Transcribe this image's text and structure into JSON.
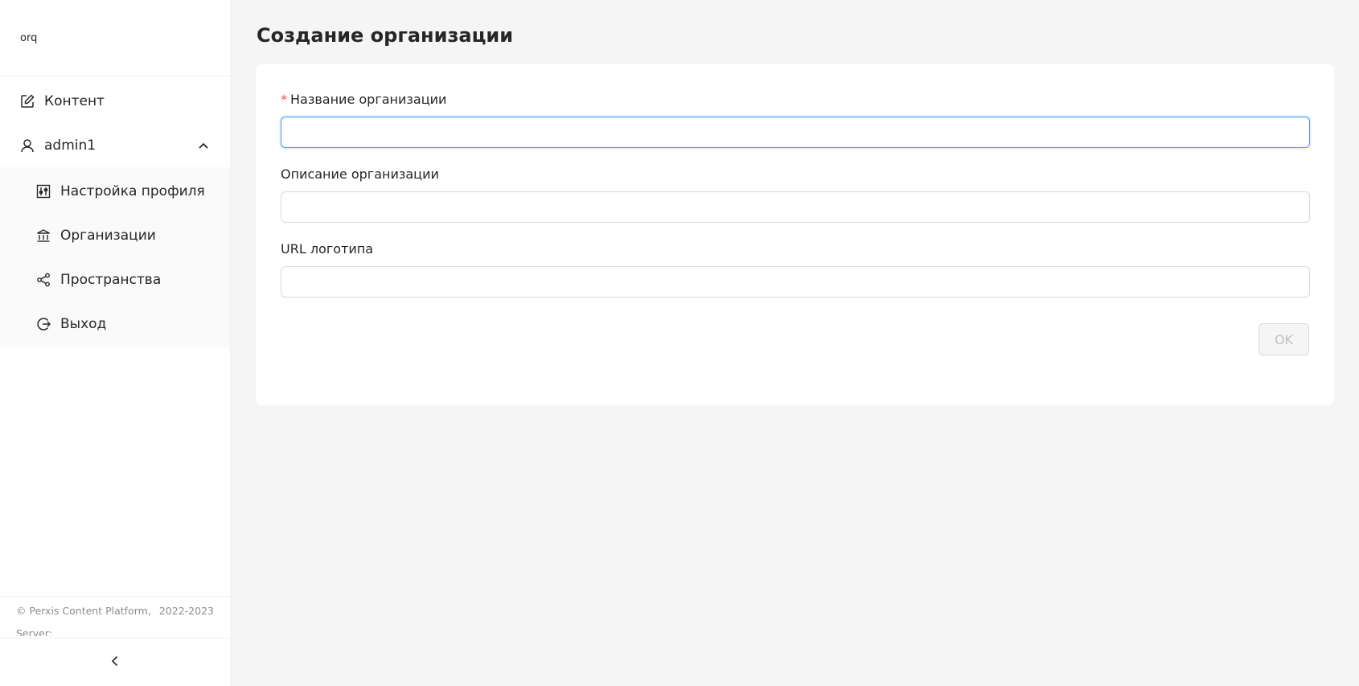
{
  "sidebar": {
    "org_label": "orq",
    "items": [
      {
        "label": "Контент"
      },
      {
        "label": "admin1"
      }
    ],
    "submenu": [
      {
        "label": "Настройка профиля"
      },
      {
        "label": "Организации"
      },
      {
        "label": "Пространства"
      },
      {
        "label": "Выход"
      }
    ],
    "footer_copyright": "© Perxis Content Platform,",
    "footer_years": "2022-2023",
    "footer_server": "Server:"
  },
  "main": {
    "title": "Создание организации",
    "form": {
      "name_required": "*",
      "name_label": "Название организации",
      "name_value": "",
      "description_label": "Описание организации",
      "description_value": "",
      "logo_label": "URL логотипа",
      "logo_value": "",
      "ok_label": "OK"
    }
  },
  "colors": {
    "accent": "#4096ff",
    "required": "#ff4d4f",
    "disabled_text": "#bfbfbf"
  }
}
